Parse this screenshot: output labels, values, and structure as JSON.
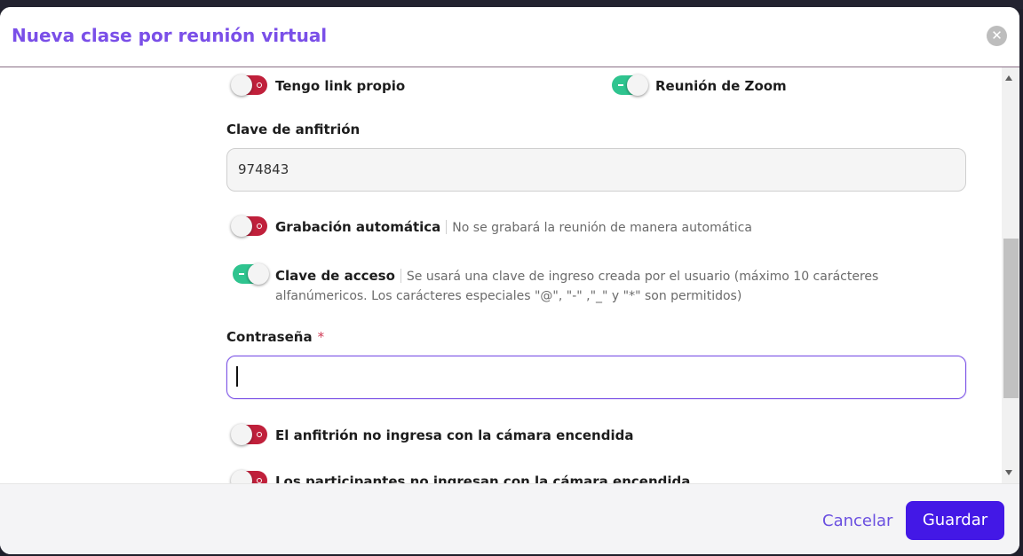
{
  "modal": {
    "title": "Nueva clase por reunión virtual",
    "close_icon": "close-icon"
  },
  "toggles": {
    "own_link": {
      "label": "Tengo link propio",
      "state": "off"
    },
    "zoom": {
      "label": "Reunión de Zoom",
      "state": "on"
    },
    "auto_record": {
      "label": "Grabación automática",
      "hint": "No se grabará la reunión de manera automática",
      "state": "off"
    },
    "access_key": {
      "label": "Clave de acceso",
      "hint_line1": "Se usará una clave de ingreso creada por el usuario (máximo 10 carácteres",
      "hint_line2": "alfanúmericos. Los carácteres especiales \"@\", \"-\" ,\"_\" y \"*\" son permitidos)",
      "state": "on"
    },
    "host_camera": {
      "label": "El anfitrión no ingresa con la cámara encendida",
      "state": "off"
    },
    "participants_camera": {
      "label": "Los participantes no ingresan con la cámara encendida",
      "state": "off"
    }
  },
  "host_key": {
    "label": "Clave de anfitrión",
    "value": "974843"
  },
  "password": {
    "label": "Contraseña",
    "required_mark": "*",
    "value": ""
  },
  "footer": {
    "cancel_label": "Cancelar",
    "save_label": "Guardar"
  },
  "colors": {
    "accent": "#4318e6",
    "title": "#7a4fe8",
    "toggle_on": "#2fc48f",
    "toggle_off": "#c0203b"
  }
}
